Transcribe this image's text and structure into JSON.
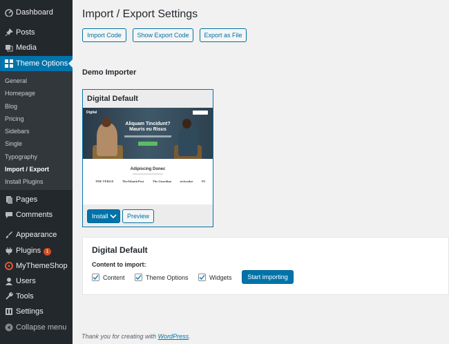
{
  "sidebar": {
    "items": [
      {
        "label": "Dashboard",
        "icon": "dashboard-icon"
      },
      {
        "label": "Posts",
        "icon": "pin-icon"
      },
      {
        "label": "Media",
        "icon": "media-icon"
      },
      {
        "label": "Theme Options",
        "icon": "grid-icon"
      },
      {
        "label": "Pages",
        "icon": "pages-icon"
      },
      {
        "label": "Comments",
        "icon": "comment-icon"
      },
      {
        "label": "Appearance",
        "icon": "brush-icon"
      },
      {
        "label": "Plugins",
        "icon": "plug-icon",
        "badge": "1"
      },
      {
        "label": "MyThemeShop",
        "icon": "mts-icon"
      },
      {
        "label": "Users",
        "icon": "user-icon"
      },
      {
        "label": "Tools",
        "icon": "wrench-icon"
      },
      {
        "label": "Settings",
        "icon": "settings-icon"
      },
      {
        "label": "Collapse menu",
        "icon": "collapse-icon"
      }
    ],
    "submenu": [
      "General",
      "Homepage",
      "Blog",
      "Pricing",
      "Sidebars",
      "Single",
      "Typography",
      "Import / Export",
      "Install Plugins"
    ],
    "active": "Theme Options",
    "current_sub": "Import / Export"
  },
  "page": {
    "title": "Import / Export Settings",
    "buttons": {
      "import_code": "Import Code",
      "show_export": "Show Export Code",
      "export_file": "Export as File"
    },
    "demo_heading": "Demo Importer"
  },
  "card": {
    "title": "Digital Default",
    "install": "Install",
    "preview": "Preview",
    "screenshot": {
      "logo": "Digital",
      "headline_1": "Aliquam Tincidunt?",
      "headline_2": "Mauris eu Risus",
      "section_title": "Adipiscing Donec",
      "logos": [
        "THE VERGE",
        "TheAtlanticPost",
        "The Guardian",
        "techradar",
        "PC"
      ]
    }
  },
  "panel": {
    "title": "Digital Default",
    "subtitle": "Content to import:",
    "options": [
      {
        "label": "Content",
        "checked": true
      },
      {
        "label": "Theme Options",
        "checked": true
      },
      {
        "label": "Widgets",
        "checked": true
      }
    ],
    "start": "Start importing"
  },
  "footer": {
    "text": "Thank you for creating with ",
    "link": "WordPress",
    "end": "."
  },
  "colors": {
    "accent": "#0073aa",
    "sidebar": "#23282d",
    "badge": "#d54e21"
  }
}
